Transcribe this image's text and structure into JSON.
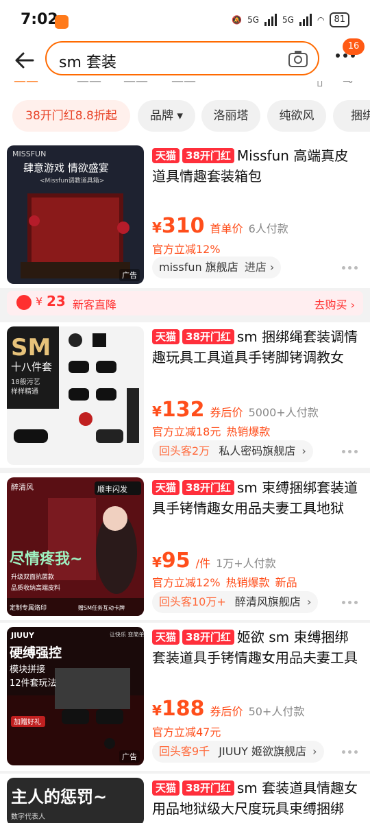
{
  "status": {
    "time": "7:02",
    "net1": "5G",
    "net2": "5G",
    "battery": "81"
  },
  "search": {
    "query": "sm 套装",
    "badge": "16"
  },
  "filter_chips": [
    "38开门红8.8折起",
    "品牌 ▾",
    "洛丽塔",
    "纯欲风",
    "捆绑"
  ],
  "coupon": {
    "yen": "¥",
    "amount": "23",
    "text": "新客直降",
    "action": "去购买 ›"
  },
  "products": [
    {
      "tags": [
        "天猫",
        "38开门红"
      ],
      "title": "Missfun 高端真皮道具情趣套装箱包",
      "yen": "¥",
      "price": "310",
      "price_note": "首单价",
      "sold": "6人付款",
      "promos": [
        "官方立减12%"
      ],
      "repeat": "",
      "shop": "missfun 旗舰店",
      "shop_action": "进店 ›",
      "ad": "广告",
      "image_text": [
        "MISSFUN",
        "肆意游戏 情欲盛宴",
        "<Missfun调教道具箱>"
      ]
    },
    {
      "tags": [
        "天猫",
        "38开门红"
      ],
      "title": "sm 捆绑绳套装调情趣玩具工具道具手铐脚铐调教女",
      "yen": "¥",
      "price": "132",
      "price_note": "券后价",
      "sold": "5000+人付款",
      "promos": [
        "官方立减18元",
        "热销爆款"
      ],
      "repeat": "回头客2万",
      "shop": "私人密码旗舰店",
      "shop_action": "›",
      "ad": "",
      "image_text": [
        "SM",
        "十八件套",
        "18般污艺",
        "样样精通"
      ]
    },
    {
      "tags": [
        "天猫",
        "38开门红"
      ],
      "title": "sm 束缚捆绑套装道具手铐情趣女用品夫妻工具地狱",
      "yen": "¥",
      "price": "95",
      "price_note": "/件",
      "sold": "1万+人付款",
      "promos": [
        "官方立减12%",
        "热销爆款",
        "新品"
      ],
      "repeat": "回头客10万+",
      "shop": "醉清风旗舰店",
      "shop_action": "›",
      "ad": "",
      "image_text": [
        "醉清风",
        "顺丰闪发",
        "尽情疼我~",
        "升级双面抗菌款",
        "品质收纳高端皮料",
        "定制专属烙印",
        "赠SM任务互动卡牌"
      ]
    },
    {
      "tags": [
        "天猫",
        "38开门红"
      ],
      "title": "姬欲 sm 束缚捆绑套装道具手铐情趣女用品夫妻工具",
      "yen": "¥",
      "price": "188",
      "price_note": "券后价",
      "sold": "50+人付款",
      "promos": [
        "官方立减47元"
      ],
      "repeat": "回头客9千",
      "shop": "JIUUY 姬欲旗舰店",
      "shop_action": "›",
      "ad": "广告",
      "image_text": [
        "JIUUY",
        "让快乐 变简单",
        "硬缚强控",
        "模块拼接",
        "12件套玩法",
        "加赠好礼"
      ]
    },
    {
      "tags": [
        "天猫",
        "38开门红"
      ],
      "title": "sm 套装道具情趣女用品地狱级大尺度玩具束缚捆绑",
      "image_text": [
        "主人的惩罚~",
        "数字代表人"
      ]
    }
  ],
  "colors": {
    "accent": "#ff4e1b",
    "tmall": "#ff2f3b",
    "search_border": "#ff6a00"
  }
}
